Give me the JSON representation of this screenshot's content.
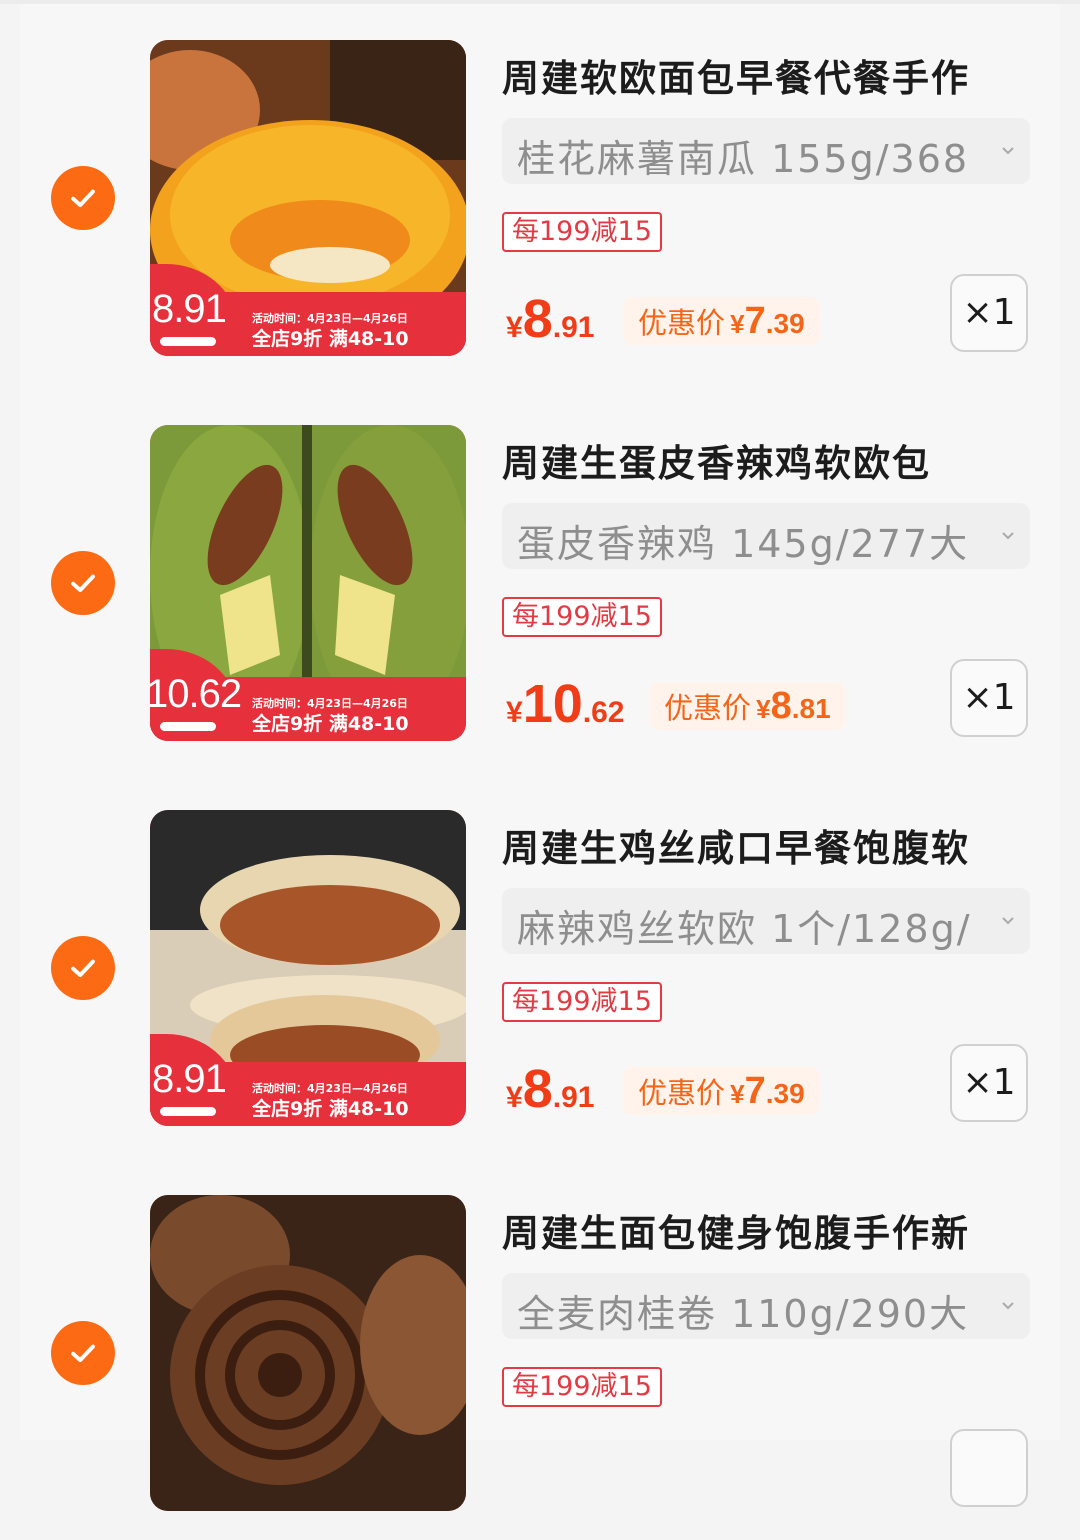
{
  "items": [
    {
      "title": "周建软欧面包早餐代餐手作",
      "spec": "桂花麻薯南瓜 155g/368",
      "coupon": "每199减15",
      "price_currency": "¥",
      "price_int": "8",
      "price_dec": ".91",
      "deal_label": "优惠价",
      "deal_currency": "¥",
      "deal_int": "7",
      "deal_dec": ".39",
      "quantity": "×1",
      "promo_price": "8.91",
      "promo_date": "活动时间：4月23日—4月26日",
      "promo_offer": "全店9折  满48-10",
      "photo": "pumpkin-bun"
    },
    {
      "title": "周建生蛋皮香辣鸡软欧包",
      "spec": "蛋皮香辣鸡 145g/277大",
      "coupon": "每199减15",
      "price_currency": "¥",
      "price_int": "10",
      "price_dec": ".62",
      "deal_label": "优惠价",
      "deal_currency": "¥",
      "deal_int": "8",
      "deal_dec": ".81",
      "quantity": "×1",
      "promo_price": "10.62",
      "promo_date": "活动时间：4月23日—4月26日",
      "promo_offer": "全店9折  满48-10",
      "photo": "matcha-chicken-bun"
    },
    {
      "title": "周建生鸡丝咸口早餐饱腹软",
      "spec": "麻辣鸡丝软欧 1个/128g/",
      "coupon": "每199减15",
      "price_currency": "¥",
      "price_int": "8",
      "price_dec": ".91",
      "deal_label": "优惠价",
      "deal_currency": "¥",
      "deal_int": "7",
      "deal_dec": ".39",
      "quantity": "×1",
      "promo_price": "8.91",
      "promo_date": "活动时间：4月23日—4月26日",
      "promo_offer": "全店9折  满48-10",
      "photo": "shredded-chicken-bun"
    },
    {
      "title": "周建生面包健身饱腹手作新",
      "spec": "全麦肉桂卷 110g/290大",
      "coupon": "每199减15",
      "photo": "cinnamon-roll"
    }
  ],
  "colors": {
    "accent": "#fc6a14",
    "price": "#f03d17",
    "coupon": "#e23b44",
    "promo_band": "#e6303b"
  }
}
